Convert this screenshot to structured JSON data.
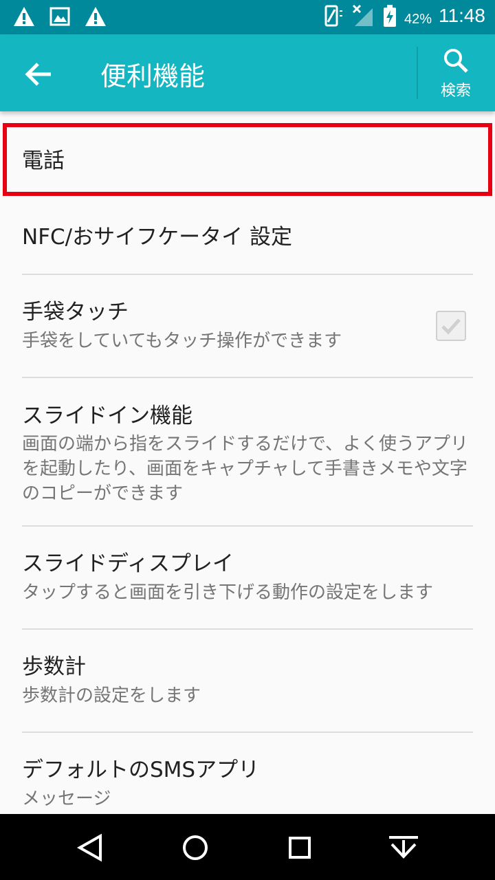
{
  "status_bar": {
    "battery_percent": "42%",
    "time": "11:48"
  },
  "app_bar": {
    "title": "便利機能",
    "search_label": "検索"
  },
  "settings": [
    {
      "title": "電話",
      "summary": ""
    },
    {
      "title": "NFC/おサイフケータイ 設定",
      "summary": ""
    },
    {
      "title": "手袋タッチ",
      "summary": "手袋をしていてもタッチ操作ができます",
      "checked": true
    },
    {
      "title": "スライドイン機能",
      "summary": "画面の端から指をスライドするだけで、よく使うアプリを起動したり、画面をキャプチャして手書きメモや文字のコピーができます"
    },
    {
      "title": "スライドディスプレイ",
      "summary": "タップすると画面を引き下げる動作の設定をします"
    },
    {
      "title": "歩数計",
      "summary": "歩数計の設定をします"
    },
    {
      "title": "デフォルトのSMSアプリ",
      "summary": "メッセージ"
    }
  ],
  "colors": {
    "app_bar": "#13b6c1",
    "status_bar": "#00899a",
    "highlight": "#e60012"
  }
}
